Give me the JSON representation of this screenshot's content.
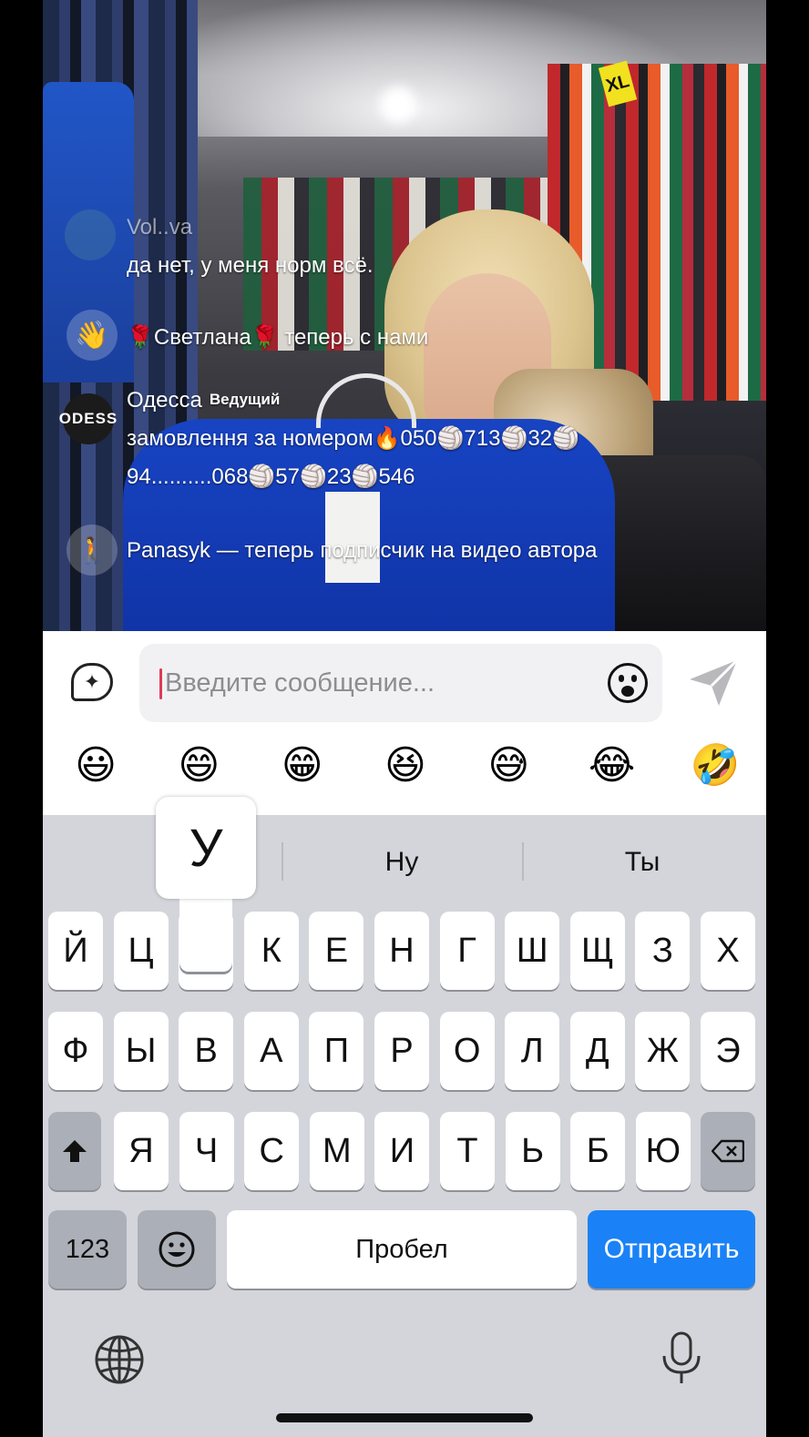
{
  "video": {
    "size_tags": [
      "XL",
      "XL"
    ]
  },
  "chat": [
    {
      "name": "Vol..va",
      "message": "да нет,  у меня норм всё."
    },
    {
      "text": "🌹Светлана🌹 теперь с нами"
    },
    {
      "name": "Одесса",
      "badge": "Ведущий",
      "line1": "замовлення за номером🔥050🏐713🏐32🏐",
      "line2": "94..........068🏐57🏐23🏐546",
      "avatar_text": "ODESS"
    },
    {
      "text": "Panasyk — теперь подписчик на видео автора"
    }
  ],
  "input": {
    "placeholder": "Введите сообщение...",
    "value": ""
  },
  "emoji_bar": [
    "😃",
    "😄",
    "😁",
    "😆",
    "😅",
    "😂",
    "🤣"
  ],
  "keyboard": {
    "suggestions": [
      "Ну",
      "Ты"
    ],
    "popup_key": "У",
    "row1": [
      "Й",
      "Ц",
      "",
      "К",
      "Е",
      "Н",
      "Г",
      "Ш",
      "Щ",
      "З",
      "Х"
    ],
    "row2": [
      "Ф",
      "Ы",
      "В",
      "А",
      "П",
      "Р",
      "О",
      "Л",
      "Д",
      "Ж",
      "Э"
    ],
    "row3": [
      "Я",
      "Ч",
      "С",
      "М",
      "И",
      "Т",
      "Ь",
      "Б",
      "Ю"
    ],
    "numbers_label": "123",
    "space_label": "Пробел",
    "send_label": "Отправить"
  },
  "colors": {
    "send_key": "#1a82f6",
    "caret": "#e03a5a",
    "keyboard_bg": "#d3d5da"
  }
}
